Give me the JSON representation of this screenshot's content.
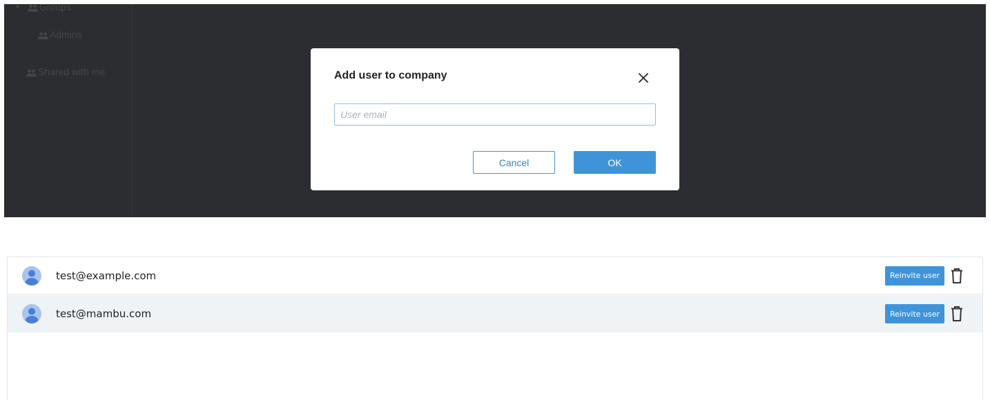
{
  "background": {
    "sidebar": {
      "groups_label": "Groups",
      "admins_label": "Admins",
      "shared_label": "Shared with me"
    }
  },
  "modal": {
    "title": "Add user to company",
    "email_placeholder": "User email",
    "email_value": "",
    "cancel_label": "Cancel",
    "ok_label": "OK"
  },
  "users": {
    "rows": [
      {
        "email": "test@example.com",
        "reinvite_label": "Reinvite user"
      },
      {
        "email": "test@mambu.com",
        "reinvite_label": "Reinvite user"
      }
    ]
  },
  "colors": {
    "accent": "#3f94d9",
    "overlay": "#2c2d31",
    "row_alt": "#eff3f6",
    "avatar": "#8aaee8"
  },
  "icons": {
    "close": "close-icon",
    "avatar": "user-avatar-icon",
    "trash": "trash-icon",
    "group": "people-icon",
    "caret": "caret-down-icon"
  }
}
